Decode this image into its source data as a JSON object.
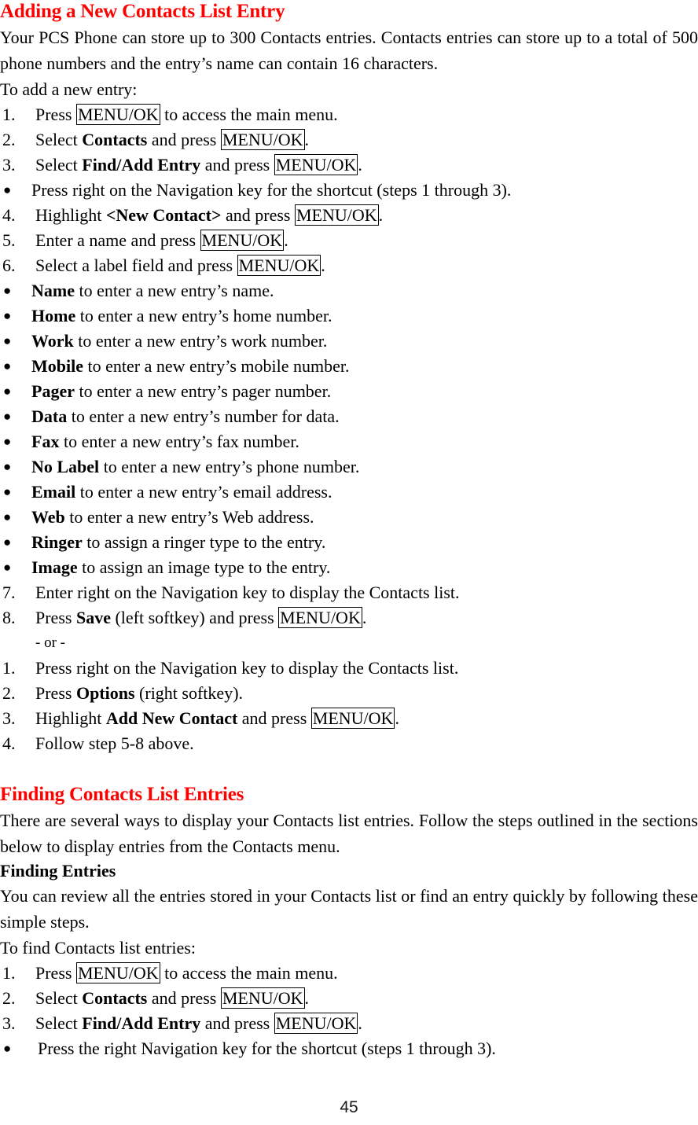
{
  "document": {
    "page_number": "45",
    "heading_color": "#FF0000",
    "text_color": "#000000"
  },
  "section1": {
    "heading": "Adding a New Contacts List Entry",
    "intro_paragraph": "Your PCS Phone can store up to 300 Contacts entries. Contacts entries can store up to a total of 500 phone numbers and the entry’s name can contain 16 characters.",
    "lead_in": "To add a new entry:",
    "steps": [
      {
        "marker": "1.",
        "type": "number",
        "pre": "Press ",
        "key": "MENU/OK",
        "post": " to access the main menu."
      },
      {
        "marker": "2.",
        "type": "number",
        "pre": "Select ",
        "bold": "Contacts",
        "mid": " and press ",
        "key": "MENU/OK",
        "post": "."
      },
      {
        "marker": "3.",
        "type": "number",
        "pre": "Select ",
        "bold": "Find/Add Entry",
        "mid": " and press ",
        "key": "MENU/OK",
        "post": "."
      },
      {
        "marker": "●",
        "type": "bullet",
        "pre": "Press right on the Navigation key for the shortcut (steps 1 through 3)."
      },
      {
        "marker": "4.",
        "type": "number",
        "pre": "Highlight ",
        "bold": "<New Contact>",
        "mid": " and press ",
        "key": "MENU/OK",
        "post": "."
      },
      {
        "marker": "5.",
        "type": "number",
        "pre": "Enter a name and press ",
        "key": "MENU/OK",
        "post": "."
      },
      {
        "marker": "6.",
        "type": "number",
        "pre": "Select a label field and press ",
        "key": "MENU/OK",
        "post": "."
      }
    ],
    "label_bullets": [
      {
        "marker": "●",
        "bold": "Name",
        "post": " to enter a new entry’s name."
      },
      {
        "marker": "●",
        "bold": "Home",
        "post": " to enter a new entry’s home number."
      },
      {
        "marker": "●",
        "bold": "Work",
        "post": " to enter a new entry’s work number."
      },
      {
        "marker": "●",
        "bold": "Mobile",
        "post": " to enter a new entry’s mobile number."
      },
      {
        "marker": "●",
        "bold": "Pager",
        "post": " to enter a new entry’s pager number."
      },
      {
        "marker": "●",
        "bold": "Data",
        "post": " to enter a new entry’s number for data."
      },
      {
        "marker": "●",
        "bold": "Fax",
        "post": " to enter a new entry’s fax number."
      },
      {
        "marker": "●",
        "bold": "No Label",
        "post": " to enter a new entry’s phone number."
      },
      {
        "marker": "●",
        "bold": "Email",
        "post": " to enter a new entry’s email address."
      },
      {
        "marker": "●",
        "bold": "Web",
        "post": " to enter a new entry’s Web address."
      },
      {
        "marker": "●",
        "bold": "Ringer",
        "post": " to assign a ringer type to the entry."
      },
      {
        "marker": "●",
        "bold": "Image",
        "post": " to assign an image type to the entry."
      }
    ],
    "steps_tail": [
      {
        "marker": "7.",
        "type": "number",
        "pre": "Enter right on the Navigation key to display the Contacts list."
      },
      {
        "marker": "8.",
        "type": "number",
        "pre": "Press ",
        "bold": "Save",
        "mid": " (left softkey) and press ",
        "key": "MENU/OK",
        "post": "."
      }
    ],
    "or_separator": "- or -",
    "steps_alt": [
      {
        "marker": "1.",
        "type": "number",
        "pre": "Press right on the Navigation key to display the Contacts list."
      },
      {
        "marker": "2.",
        "type": "number",
        "pre": "Press ",
        "bold": "Options",
        "mid": " (right softkey)."
      },
      {
        "marker": "3.",
        "type": "number",
        "pre": "Highlight ",
        "bold": "Add New Contact",
        "mid": " and press ",
        "key": "MENU/OK",
        "post": "."
      },
      {
        "marker": "4.",
        "type": "number",
        "pre": "Follow step 5-8 above."
      }
    ]
  },
  "section2": {
    "heading": "Finding Contacts List Entries",
    "intro_paragraph": "There are several ways to display your Contacts list entries. Follow the steps outlined in the sections below to display entries from the Contacts menu.",
    "subheading": "Finding Entries",
    "paragraph": "You can review all the entries stored in your Contacts list or find an entry quickly by following these simple steps.",
    "lead_in": "To find Contacts list entries:",
    "steps": [
      {
        "marker": "1.",
        "type": "number",
        "pre": "Press ",
        "key": "MENU/OK",
        "post": " to access the main menu."
      },
      {
        "marker": "2.",
        "type": "number",
        "pre": "Select ",
        "bold": "Contacts",
        "mid": " and press ",
        "key": "MENU/OK",
        "post": "."
      },
      {
        "marker": "3.",
        "type": "number",
        "pre": "Select ",
        "bold": "Find/Add Entry",
        "mid": " and press ",
        "key": "MENU/OK",
        "post": "."
      },
      {
        "marker": "●",
        "type": "bullet-wide",
        "pre": " Press the right Navigation key for the shortcut (steps 1 through 3)."
      }
    ]
  }
}
